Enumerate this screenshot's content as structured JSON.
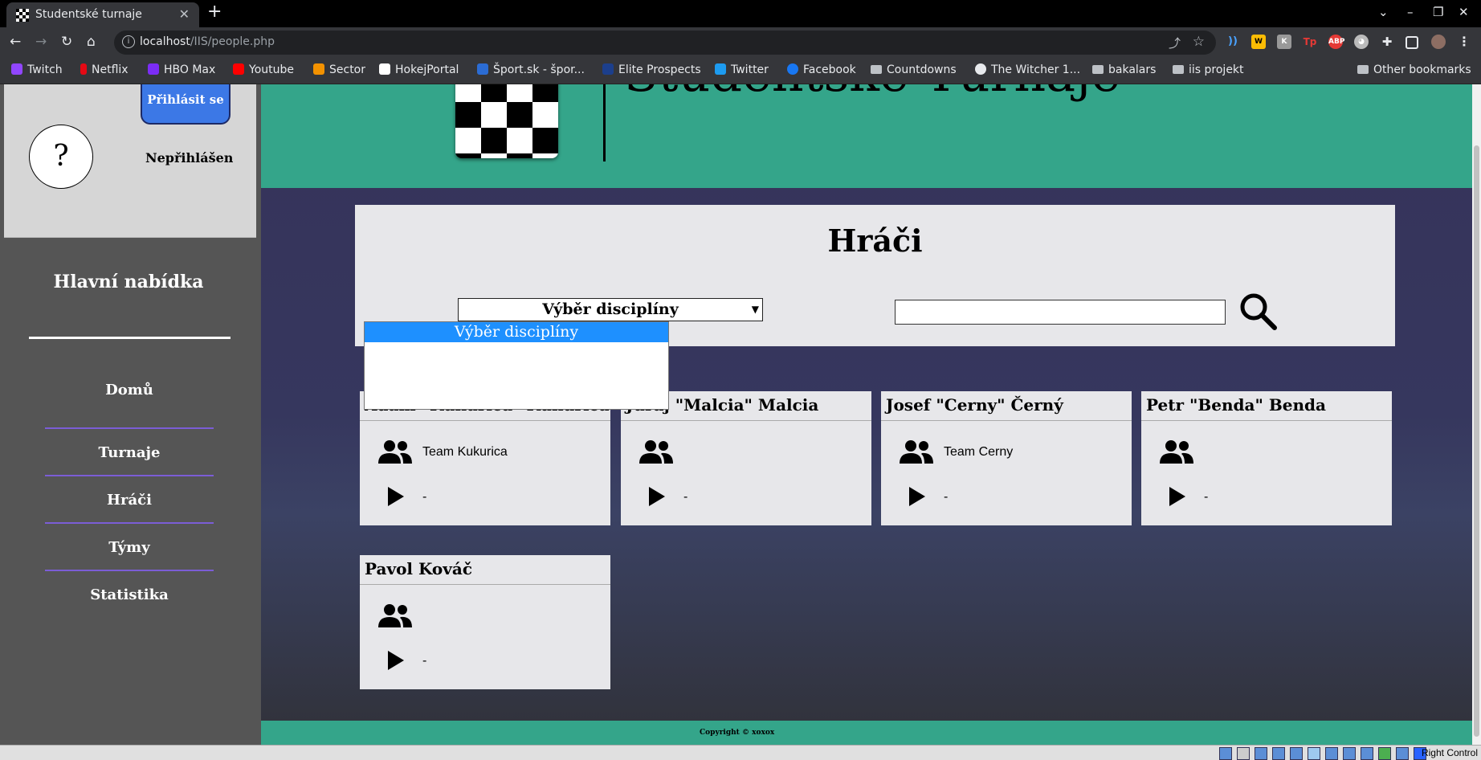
{
  "browser": {
    "tab_title": "Studentské turnaje",
    "new_tab": "+",
    "url_host": "localhost",
    "url_path": "/IIS/people.php"
  },
  "bookmarks": [
    {
      "label": "Twitch",
      "icon": "twitch-icon",
      "color": "#9146ff"
    },
    {
      "label": "Netflix",
      "icon": "netflix-icon",
      "color": "#e50914"
    },
    {
      "label": "HBO Max",
      "icon": "hbomax-icon",
      "color": "#7b2cf5"
    },
    {
      "label": "Youtube",
      "icon": "youtube-icon",
      "color": "#ff0000"
    },
    {
      "label": "Sector",
      "icon": "sector-icon",
      "color": "#f39200"
    },
    {
      "label": "HokejPortal",
      "icon": "hokejportal-icon",
      "color": "#ffffff"
    },
    {
      "label": "Šport.sk - špor...",
      "icon": "sport-icon",
      "color": "#2b6cd4"
    },
    {
      "label": "Elite Prospects",
      "icon": "eliteprospects-icon",
      "color": "#1c3f8c"
    },
    {
      "label": "Twitter",
      "icon": "twitter-icon",
      "color": "#1d9bf0"
    },
    {
      "label": "Facebook",
      "icon": "facebook-icon",
      "color": "#1877f2"
    },
    {
      "label": "Countdowns",
      "icon": "folder-icon",
      "color": ""
    },
    {
      "label": "The Witcher 1...",
      "icon": "globe-icon",
      "color": "#e8eaed"
    },
    {
      "label": "bakalars",
      "icon": "folder-icon",
      "color": ""
    },
    {
      "label": "iis projekt",
      "icon": "folder-icon",
      "color": ""
    }
  ],
  "other_bookmarks": "Other bookmarks",
  "sidebar": {
    "login_button": "Přihlásit se",
    "avatar": "?",
    "status": "Nepřihlášen",
    "menu_title": "Hlavní nabídka",
    "items": [
      {
        "label": "Domů"
      },
      {
        "label": "Turnaje"
      },
      {
        "label": "Hráči"
      },
      {
        "label": "Týmy"
      },
      {
        "label": "Statistika"
      }
    ]
  },
  "header": {
    "site_title": "Studentské Turnaje"
  },
  "filter": {
    "page_title": "Hráči",
    "select_value": "Výběr disciplíny",
    "dropdown_options": [
      "Výběr disciplíny"
    ],
    "search_value": ""
  },
  "players": [
    {
      "name": "Adam \"Kukurica\" Kukurica",
      "team": "Team Kukurica",
      "game": "-"
    },
    {
      "name": "Juraj \"Malcia\" Malcia",
      "team": "",
      "game": "-"
    },
    {
      "name": "Josef \"Cerny\" Černý",
      "team": "Team Cerny",
      "game": "-"
    },
    {
      "name": "Petr \"Benda\" Benda",
      "team": "",
      "game": "-"
    },
    {
      "name": "Pavol Kováč",
      "team": "",
      "game": "-"
    }
  ],
  "footer": {
    "copyright": "Copyright © xoxox"
  },
  "host": {
    "right_control": "Right Control"
  },
  "colors": {
    "header_green": "#34a58a",
    "sidebar_gray": "#555555",
    "login_blue": "#3c78e6",
    "menu_separator": "#7b5dd6",
    "dropdown_highlight": "#1e90ff"
  }
}
